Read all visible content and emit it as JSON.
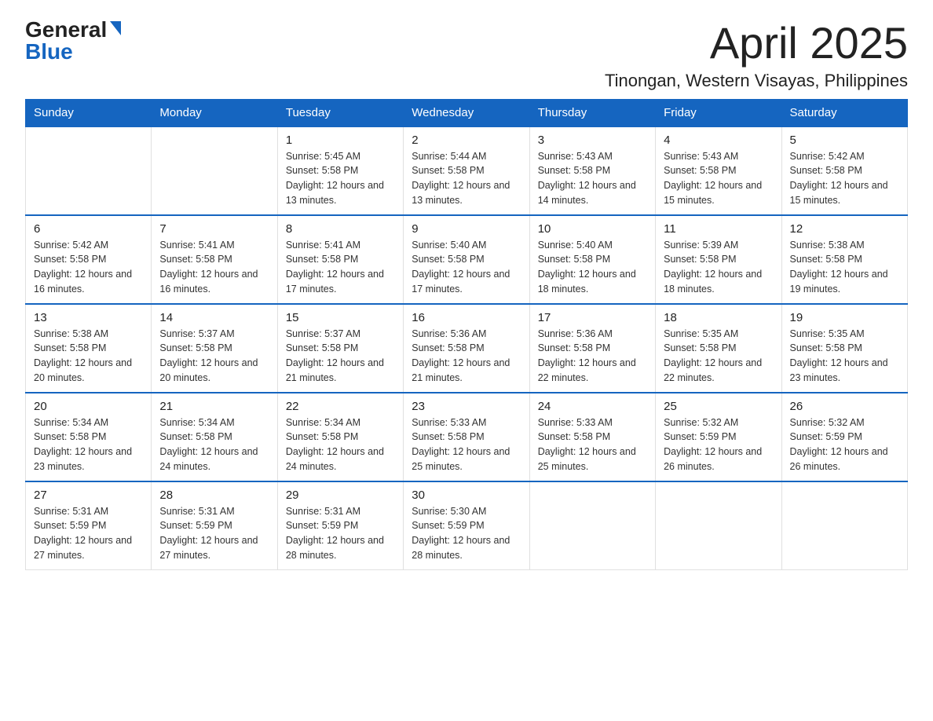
{
  "logo": {
    "general": "General",
    "blue": "Blue"
  },
  "header": {
    "month": "April 2025",
    "location": "Tinongan, Western Visayas, Philippines"
  },
  "days_of_week": [
    "Sunday",
    "Monday",
    "Tuesday",
    "Wednesday",
    "Thursday",
    "Friday",
    "Saturday"
  ],
  "weeks": [
    [
      {
        "day": "",
        "sunrise": "",
        "sunset": "",
        "daylight": ""
      },
      {
        "day": "",
        "sunrise": "",
        "sunset": "",
        "daylight": ""
      },
      {
        "day": "1",
        "sunrise": "Sunrise: 5:45 AM",
        "sunset": "Sunset: 5:58 PM",
        "daylight": "Daylight: 12 hours and 13 minutes."
      },
      {
        "day": "2",
        "sunrise": "Sunrise: 5:44 AM",
        "sunset": "Sunset: 5:58 PM",
        "daylight": "Daylight: 12 hours and 13 minutes."
      },
      {
        "day": "3",
        "sunrise": "Sunrise: 5:43 AM",
        "sunset": "Sunset: 5:58 PM",
        "daylight": "Daylight: 12 hours and 14 minutes."
      },
      {
        "day": "4",
        "sunrise": "Sunrise: 5:43 AM",
        "sunset": "Sunset: 5:58 PM",
        "daylight": "Daylight: 12 hours and 15 minutes."
      },
      {
        "day": "5",
        "sunrise": "Sunrise: 5:42 AM",
        "sunset": "Sunset: 5:58 PM",
        "daylight": "Daylight: 12 hours and 15 minutes."
      }
    ],
    [
      {
        "day": "6",
        "sunrise": "Sunrise: 5:42 AM",
        "sunset": "Sunset: 5:58 PM",
        "daylight": "Daylight: 12 hours and 16 minutes."
      },
      {
        "day": "7",
        "sunrise": "Sunrise: 5:41 AM",
        "sunset": "Sunset: 5:58 PM",
        "daylight": "Daylight: 12 hours and 16 minutes."
      },
      {
        "day": "8",
        "sunrise": "Sunrise: 5:41 AM",
        "sunset": "Sunset: 5:58 PM",
        "daylight": "Daylight: 12 hours and 17 minutes."
      },
      {
        "day": "9",
        "sunrise": "Sunrise: 5:40 AM",
        "sunset": "Sunset: 5:58 PM",
        "daylight": "Daylight: 12 hours and 17 minutes."
      },
      {
        "day": "10",
        "sunrise": "Sunrise: 5:40 AM",
        "sunset": "Sunset: 5:58 PM",
        "daylight": "Daylight: 12 hours and 18 minutes."
      },
      {
        "day": "11",
        "sunrise": "Sunrise: 5:39 AM",
        "sunset": "Sunset: 5:58 PM",
        "daylight": "Daylight: 12 hours and 18 minutes."
      },
      {
        "day": "12",
        "sunrise": "Sunrise: 5:38 AM",
        "sunset": "Sunset: 5:58 PM",
        "daylight": "Daylight: 12 hours and 19 minutes."
      }
    ],
    [
      {
        "day": "13",
        "sunrise": "Sunrise: 5:38 AM",
        "sunset": "Sunset: 5:58 PM",
        "daylight": "Daylight: 12 hours and 20 minutes."
      },
      {
        "day": "14",
        "sunrise": "Sunrise: 5:37 AM",
        "sunset": "Sunset: 5:58 PM",
        "daylight": "Daylight: 12 hours and 20 minutes."
      },
      {
        "day": "15",
        "sunrise": "Sunrise: 5:37 AM",
        "sunset": "Sunset: 5:58 PM",
        "daylight": "Daylight: 12 hours and 21 minutes."
      },
      {
        "day": "16",
        "sunrise": "Sunrise: 5:36 AM",
        "sunset": "Sunset: 5:58 PM",
        "daylight": "Daylight: 12 hours and 21 minutes."
      },
      {
        "day": "17",
        "sunrise": "Sunrise: 5:36 AM",
        "sunset": "Sunset: 5:58 PM",
        "daylight": "Daylight: 12 hours and 22 minutes."
      },
      {
        "day": "18",
        "sunrise": "Sunrise: 5:35 AM",
        "sunset": "Sunset: 5:58 PM",
        "daylight": "Daylight: 12 hours and 22 minutes."
      },
      {
        "day": "19",
        "sunrise": "Sunrise: 5:35 AM",
        "sunset": "Sunset: 5:58 PM",
        "daylight": "Daylight: 12 hours and 23 minutes."
      }
    ],
    [
      {
        "day": "20",
        "sunrise": "Sunrise: 5:34 AM",
        "sunset": "Sunset: 5:58 PM",
        "daylight": "Daylight: 12 hours and 23 minutes."
      },
      {
        "day": "21",
        "sunrise": "Sunrise: 5:34 AM",
        "sunset": "Sunset: 5:58 PM",
        "daylight": "Daylight: 12 hours and 24 minutes."
      },
      {
        "day": "22",
        "sunrise": "Sunrise: 5:34 AM",
        "sunset": "Sunset: 5:58 PM",
        "daylight": "Daylight: 12 hours and 24 minutes."
      },
      {
        "day": "23",
        "sunrise": "Sunrise: 5:33 AM",
        "sunset": "Sunset: 5:58 PM",
        "daylight": "Daylight: 12 hours and 25 minutes."
      },
      {
        "day": "24",
        "sunrise": "Sunrise: 5:33 AM",
        "sunset": "Sunset: 5:58 PM",
        "daylight": "Daylight: 12 hours and 25 minutes."
      },
      {
        "day": "25",
        "sunrise": "Sunrise: 5:32 AM",
        "sunset": "Sunset: 5:59 PM",
        "daylight": "Daylight: 12 hours and 26 minutes."
      },
      {
        "day": "26",
        "sunrise": "Sunrise: 5:32 AM",
        "sunset": "Sunset: 5:59 PM",
        "daylight": "Daylight: 12 hours and 26 minutes."
      }
    ],
    [
      {
        "day": "27",
        "sunrise": "Sunrise: 5:31 AM",
        "sunset": "Sunset: 5:59 PM",
        "daylight": "Daylight: 12 hours and 27 minutes."
      },
      {
        "day": "28",
        "sunrise": "Sunrise: 5:31 AM",
        "sunset": "Sunset: 5:59 PM",
        "daylight": "Daylight: 12 hours and 27 minutes."
      },
      {
        "day": "29",
        "sunrise": "Sunrise: 5:31 AM",
        "sunset": "Sunset: 5:59 PM",
        "daylight": "Daylight: 12 hours and 28 minutes."
      },
      {
        "day": "30",
        "sunrise": "Sunrise: 5:30 AM",
        "sunset": "Sunset: 5:59 PM",
        "daylight": "Daylight: 12 hours and 28 minutes."
      },
      {
        "day": "",
        "sunrise": "",
        "sunset": "",
        "daylight": ""
      },
      {
        "day": "",
        "sunrise": "",
        "sunset": "",
        "daylight": ""
      },
      {
        "day": "",
        "sunrise": "",
        "sunset": "",
        "daylight": ""
      }
    ]
  ]
}
